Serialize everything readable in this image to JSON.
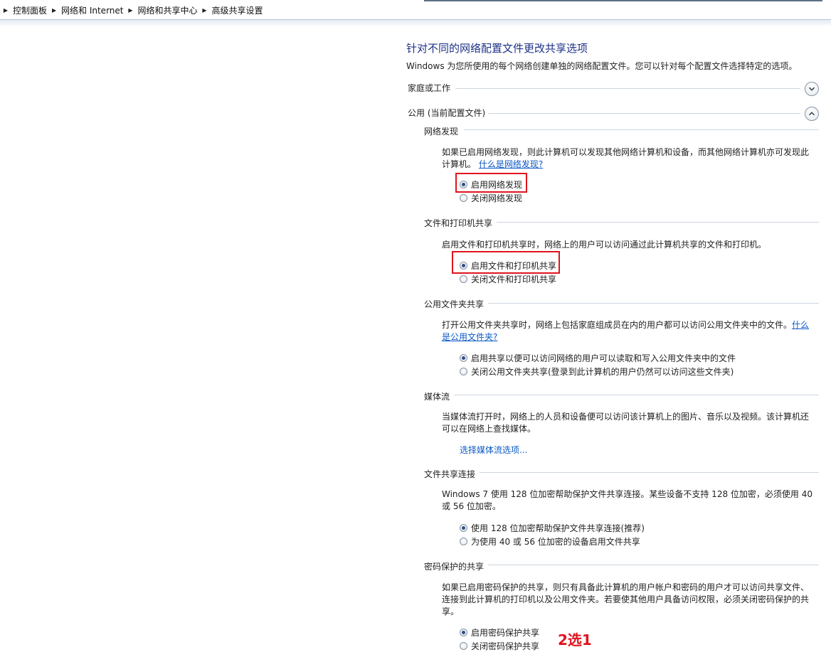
{
  "breadcrumb": [
    "控制面板",
    "网络和 Internet",
    "网络和共享中心",
    "高级共享设置"
  ],
  "page": {
    "title": "针对不同的网络配置文件更改共享选项",
    "description": "Windows 为您所使用的每个网络创建单独的网络配置文件。您可以针对每个配置文件选择特定的选项。"
  },
  "profiles": {
    "home": {
      "label": "家庭或工作",
      "expanded": false
    },
    "public": {
      "label": "公用 (当前配置文件)",
      "expanded": true
    }
  },
  "sections": {
    "network_discovery": {
      "heading": "网络发现",
      "desc_line1": "如果已启用网络发现，则此计算机可以发现其他网络计算机和设备，而其他网络计算机亦可发现此",
      "desc_line2": "计算机。",
      "link": "什么是网络发现?",
      "options": [
        "启用网络发现",
        "关闭网络发现"
      ],
      "selected": 0
    },
    "file_printer": {
      "heading": "文件和打印机共享",
      "desc": "启用文件和打印机共享时，网络上的用户可以访问通过此计算机共享的文件和打印机。",
      "options": [
        "启用文件和打印机共享",
        "关闭文件和打印机共享"
      ],
      "selected": 0
    },
    "public_folder": {
      "heading": "公用文件夹共享",
      "desc_line1": "打开公用文件夹共享时，网络上包括家庭组成员在内的用户都可以访问公用文件夹中的文件。",
      "link_part1": "什么",
      "link_part2": "是公用文件夹?",
      "options": [
        "启用共享以便可以访问网络的用户可以读取和写入公用文件夹中的文件",
        "关闭公用文件夹共享(登录到此计算机的用户仍然可以访问这些文件夹)"
      ],
      "selected": 0
    },
    "media_streaming": {
      "heading": "媒体流",
      "desc_line1": "当媒体流打开时，网络上的人员和设备便可以访问该计算机上的图片、音乐以及视频。该计算机还",
      "desc_line2": "可以在网络上查找媒体。",
      "link": "选择媒体流选项..."
    },
    "file_sharing_conn": {
      "heading": "文件共享连接",
      "desc_line1": "Windows 7 使用 128 位加密帮助保护文件共享连接。某些设备不支持 128 位加密，必须使用 40",
      "desc_line2": "或 56 位加密。",
      "options": [
        "使用 128 位加密帮助保护文件共享连接(推荐)",
        "为使用 40 或 56 位加密的设备启用文件共享"
      ],
      "selected": 0
    },
    "password_protected": {
      "heading": "密码保护的共享",
      "desc_line1": "如果已启用密码保护的共享，则只有具备此计算机的用户帐户和密码的用户才可以访问共享文件、",
      "desc_line2": "连接到此计算机的打印机以及公用文件夹。若要使其他用户具备访问权限，必须关闭密码保护的共",
      "desc_line3": "享。",
      "options": [
        "启用密码保护共享",
        "关闭密码保护共享"
      ],
      "selected": 0
    }
  },
  "annotation": "2选1",
  "colors": {
    "title": "#1e3287",
    "link": "#0b58c6",
    "highlight": "#e0141e"
  },
  "icons": {
    "breadcrumb_separator": "triangle-right-icon",
    "expand": "chevron-down-icon",
    "collapse": "chevron-up-icon"
  }
}
